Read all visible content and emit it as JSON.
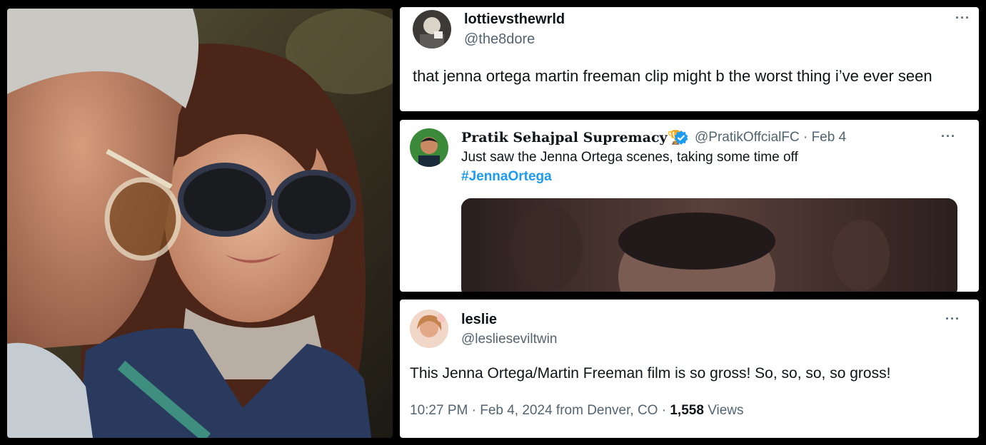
{
  "tweet1": {
    "display_name": "lottievsthewrld",
    "handle": "@the8dore",
    "text": "that jenna ortega martin freeman clip might b the worst thing i’ve ever seen",
    "more_icon": "more-icon"
  },
  "tweet2": {
    "display_name": "Pratik Sehajpal Supremacy",
    "badge_emoji": "🏆",
    "handle": "@PratikOffcialFC",
    "separator": "·",
    "date": "Feb 4",
    "text": "Just saw the Jenna Ortega scenes, taking some time off",
    "hashtag": "#JennaOrtega",
    "verified_icon": "verified-badge-icon",
    "more_icon": "more-icon"
  },
  "tweet3": {
    "display_name": "leslie",
    "handle": "@lesliesevi ltwin",
    "text": "This Jenna Ortega/Martin Freeman film is so gross! So, so, so, so gross!",
    "time": "10:27 PM",
    "sep1": "·",
    "date": "Feb 4, 2024",
    "location": "from Denver, CO",
    "sep2": "·",
    "views_count": "1,558",
    "views_label": "Views",
    "more_icon": "more-icon"
  },
  "colors": {
    "link": "#1d9bf0",
    "secondary_text": "#536471",
    "primary_text": "#0f1419",
    "verified": "#1d9bf0"
  }
}
